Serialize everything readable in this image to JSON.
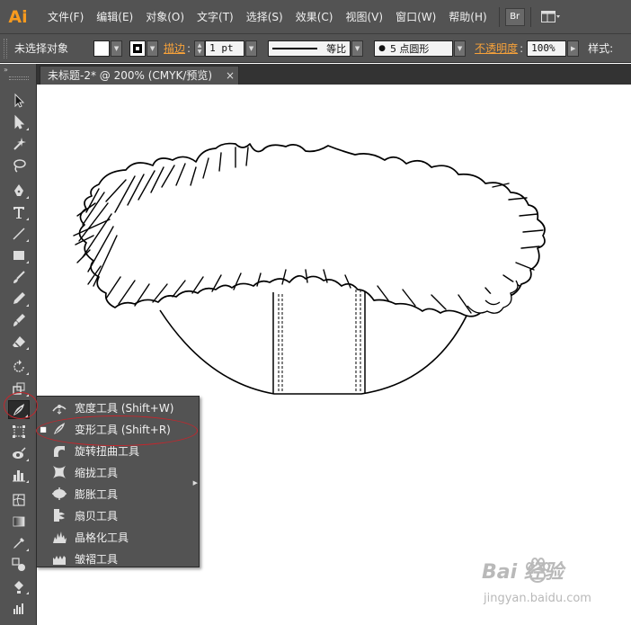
{
  "app": {
    "logo_text": "Ai"
  },
  "menubar": {
    "items": [
      "文件(F)",
      "编辑(E)",
      "对象(O)",
      "文字(T)",
      "选择(S)",
      "效果(C)",
      "视图(V)",
      "窗口(W)",
      "帮助(H)"
    ],
    "bridge_label": "Br"
  },
  "controlbar": {
    "selection_status": "未选择对象",
    "stroke_label": "描边",
    "stroke_weight": "1 pt",
    "profile_label": "等比",
    "brush_label": "5 点圆形",
    "opacity_label": "不透明度",
    "opacity_value": "100%",
    "style_label": "样式:"
  },
  "document": {
    "tab_title": "未标题-2* @ 200% (CMYK/预览)",
    "close_glyph": "×"
  },
  "toolbar": {
    "collapse_glyph": "»",
    "tools": [
      "selection-tool",
      "direct-selection-tool",
      "magic-wand-tool",
      "lasso-tool",
      "pen-tool",
      "type-tool",
      "line-segment-tool",
      "rectangle-tool",
      "paintbrush-tool",
      "pencil-tool",
      "blob-brush-tool",
      "eraser-tool",
      "rotate-tool",
      "scale-tool",
      "warp-tool",
      "free-transform-tool",
      "symbol-sprayer-tool",
      "column-graph-tool",
      "mesh-tool",
      "gradient-tool",
      "eyedropper-tool",
      "blend-tool",
      "live-paint-tool",
      "graph-tool"
    ],
    "active_tool": "warp-tool"
  },
  "flyout": {
    "items": [
      {
        "label": "宽度工具  (Shift+W)",
        "icon": "width-tool-icon",
        "selected": false
      },
      {
        "label": "变形工具  (Shift+R)",
        "icon": "warp-tool-icon",
        "selected": true
      },
      {
        "label": "旋转扭曲工具",
        "icon": "twirl-tool-icon",
        "selected": false
      },
      {
        "label": "缩拢工具",
        "icon": "pucker-tool-icon",
        "selected": false
      },
      {
        "label": "膨胀工具",
        "icon": "bloat-tool-icon",
        "selected": false
      },
      {
        "label": "扇贝工具",
        "icon": "scallop-tool-icon",
        "selected": false
      },
      {
        "label": "晶格化工具",
        "icon": "crystallize-tool-icon",
        "selected": false
      },
      {
        "label": "皱褶工具",
        "icon": "wrinkle-tool-icon",
        "selected": false
      }
    ]
  },
  "watermark": {
    "brand": "Bai 经验",
    "site": "jingyan.baidu.com"
  },
  "colors": {
    "chrome": "#535353",
    "accent_orange": "#f79a1e",
    "annotation_red": "#c2272d"
  }
}
